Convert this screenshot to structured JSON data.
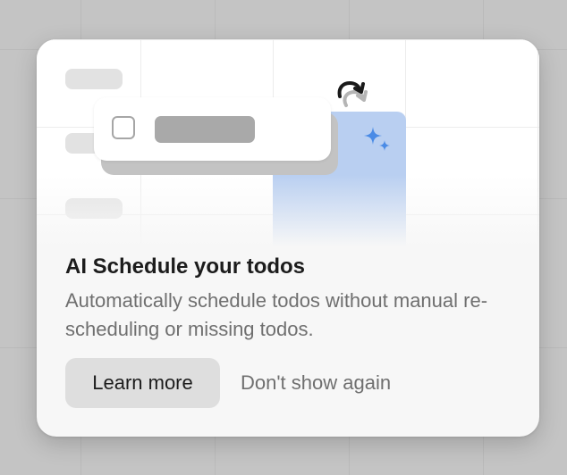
{
  "dialog": {
    "title": "AI Schedule your todos",
    "description": "Automatically schedule todos without manual re-scheduling or missing todos.",
    "learn_more_label": "Learn more",
    "dont_show_again_label": "Don't show again"
  },
  "illustration": {
    "icons": [
      "redo-arrow-icon",
      "sparkle-icon",
      "checkbox-icon"
    ]
  },
  "colors": {
    "backdrop": "#c4c4c4",
    "card_bg": "#f7f7f7",
    "accent_blue": "#b9cff1",
    "sparkle_blue": "#4a8be6",
    "primary_button_bg": "#dedede",
    "title_text": "#1c1c1c",
    "secondary_text": "#6f6f6f"
  }
}
